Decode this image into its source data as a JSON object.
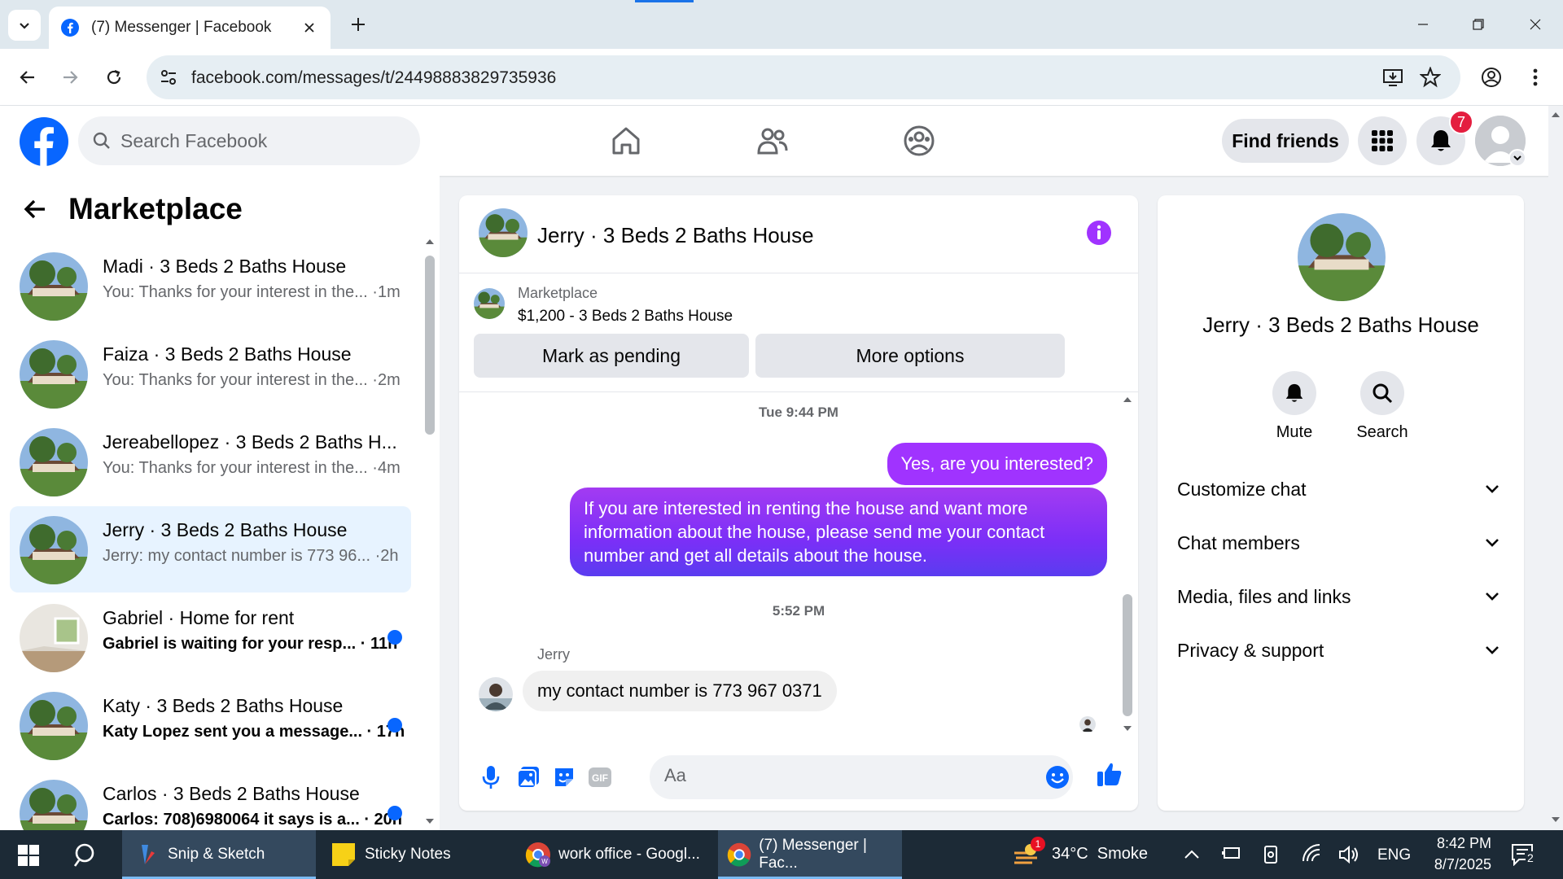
{
  "browser": {
    "tab_title": "(7) Messenger | Facebook",
    "url": "facebook.com/messages/t/24498883829735936"
  },
  "fb": {
    "search_placeholder": "Search Facebook",
    "find_friends": "Find friends",
    "notif_count": "7"
  },
  "sidebar": {
    "title": "Marketplace",
    "conversations": [
      {
        "name": "Madi · 3 Beds 2 Baths House",
        "preview": "You: Thanks for your interest in the... ·1m",
        "unread": false,
        "active": false
      },
      {
        "name": "Faiza · 3 Beds 2 Baths House",
        "preview": "You: Thanks for your interest in the... ·2m",
        "unread": false,
        "active": false
      },
      {
        "name": "Jereabellopez · 3 Beds 2 Baths H...",
        "preview": "You: Thanks for your interest in the... ·4m",
        "unread": false,
        "active": false
      },
      {
        "name": "Jerry · 3 Beds 2 Baths House",
        "preview": "Jerry: my contact number is 773 96... ·2h",
        "unread": false,
        "active": true
      },
      {
        "name": "Gabriel · Home for rent",
        "preview": "Gabriel is waiting for your resp... · 11h",
        "unread": true,
        "active": false
      },
      {
        "name": "Katy · 3 Beds 2 Baths House",
        "preview": "Katy Lopez sent you a message... · 17h",
        "unread": true,
        "active": false
      },
      {
        "name": "Carlos · 3 Beds 2 Baths House",
        "preview": "Carlos: 708)6980064 it says is a... · 20h",
        "unread": true,
        "active": false
      }
    ]
  },
  "chat": {
    "title": "Jerry · 3 Beds 2 Baths House",
    "marketplace_label": "Marketplace",
    "listing": "$1,200 - 3 Beds 2 Baths House",
    "mark_pending": "Mark as pending",
    "more_options": "More options",
    "time1": "Tue 9:44 PM",
    "out_msg1": "Yes, are you interested?",
    "out_msg2": "If you are interested in renting the house and want more information about the house, please send me your contact number and get all details about the house.",
    "time2": "5:52 PM",
    "sender": "Jerry",
    "in_msg": "my contact number is 773 967 0371",
    "composer_placeholder": "Aa"
  },
  "rpanel": {
    "name": "Jerry · 3 Beds 2 Baths House",
    "mute": "Mute",
    "search": "Search",
    "items": [
      "Customize chat",
      "Chat members",
      "Media, files and links",
      "Privacy & support"
    ]
  },
  "taskbar": {
    "apps": [
      "Snip & Sketch",
      "Sticky Notes",
      "work office - Googl...",
      "(7) Messenger | Fac..."
    ],
    "weather": "34°C  Smoke",
    "weather_badge": "1",
    "lang": "ENG",
    "time": "8:42 PM",
    "date": "8/7/2025",
    "notif": "2"
  },
  "colors": {
    "fb_blue": "#0866ff",
    "messenger_purple": "#a033ff",
    "active_bg": "#e7f3ff"
  }
}
